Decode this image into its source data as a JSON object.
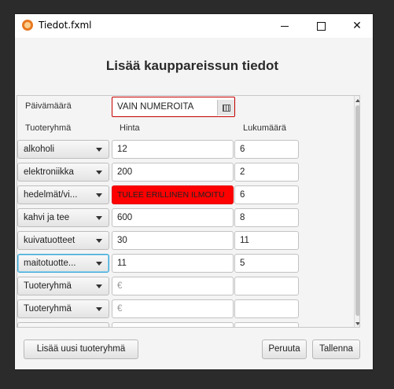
{
  "window": {
    "title": "Tiedot.fxml",
    "controls": {
      "minimize": "minimize-icon",
      "maximize": "maximize-icon",
      "close": "close-icon"
    }
  },
  "heading": "Lisää kauppareissun tiedot",
  "date": {
    "label": "Päivämäärä",
    "value": "VAIN NUMEROITA",
    "icon": "calendar-icon"
  },
  "columns": {
    "group": "Tuoteryhmä",
    "price": "Hinta",
    "quantity": "Lukumäärä"
  },
  "rows": [
    {
      "group": "alkoholi",
      "price": "12",
      "quantity": "6"
    },
    {
      "group": "elektroniikka",
      "price": "200",
      "quantity": "2"
    },
    {
      "group": "hedelmät/vi...",
      "price": "TULEE ERILLINEN ILMOITU",
      "quantity": "6",
      "price_error": true
    },
    {
      "group": "kahvi ja tee",
      "price": "600",
      "quantity": "8"
    },
    {
      "group": "kuivatuotteet",
      "price": "30",
      "quantity": "11"
    },
    {
      "group": "maitotuotte...",
      "price": "11",
      "quantity": "5",
      "focused": true
    },
    {
      "group": "Tuoteryhmä",
      "price_placeholder": "€",
      "quantity": ""
    },
    {
      "group": "Tuoteryhmä",
      "price_placeholder": "€",
      "quantity": ""
    }
  ],
  "buttons": {
    "add_group": "Lisää uusi tuoteryhmä",
    "cancel": "Peruuta",
    "save": "Tallenna"
  },
  "colors": {
    "error": "#ff0000",
    "focus": "#39a8d8",
    "app_icon": "#e8791f"
  }
}
